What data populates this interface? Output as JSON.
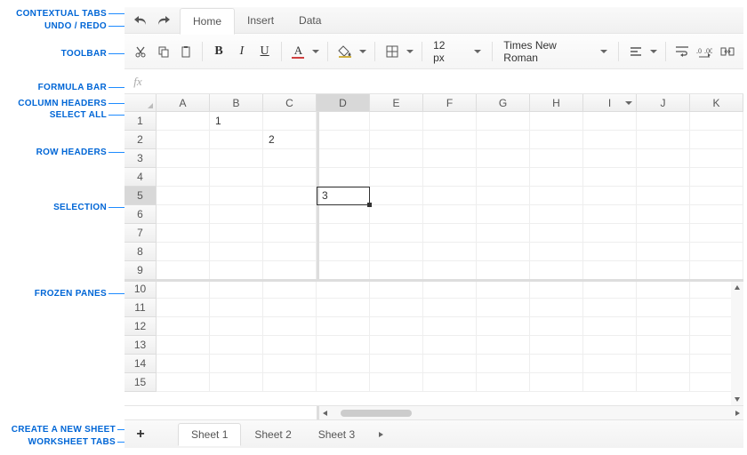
{
  "annotations": {
    "contextual_tabs": "CONTEXTUAL TABS",
    "undo_redo": "UNDO / REDO",
    "toolbar": "TOOLBAR",
    "formula_bar": "FORMULA BAR",
    "column_headers": "COLUMN HEADERS",
    "select_all": "SELECT ALL",
    "row_headers": "ROW HEADERS",
    "selection": "SELECTION",
    "frozen_panes": "FROZEN PANES",
    "create_sheet": "CREATE A NEW SHEET",
    "worksheet_tabs": "WORKSHEET TABS"
  },
  "tabs": {
    "home": "Home",
    "insert": "Insert",
    "data": "Data"
  },
  "toolbar": {
    "font_size": "12 px",
    "font_name": "Times New Roman"
  },
  "formula": {
    "fx": "fx",
    "value": ""
  },
  "columns": [
    "A",
    "B",
    "C",
    "D",
    "E",
    "F",
    "G",
    "H",
    "I",
    "J",
    "K"
  ],
  "rows": [
    "1",
    "2",
    "3",
    "4",
    "5",
    "6",
    "7",
    "8",
    "9",
    "10",
    "11",
    "12",
    "13",
    "14",
    "15"
  ],
  "cells": {
    "B1": "1",
    "C2": "2",
    "D5": "3"
  },
  "sheets": {
    "add": "+",
    "s1": "Sheet 1",
    "s2": "Sheet 2",
    "s3": "Sheet 3"
  }
}
